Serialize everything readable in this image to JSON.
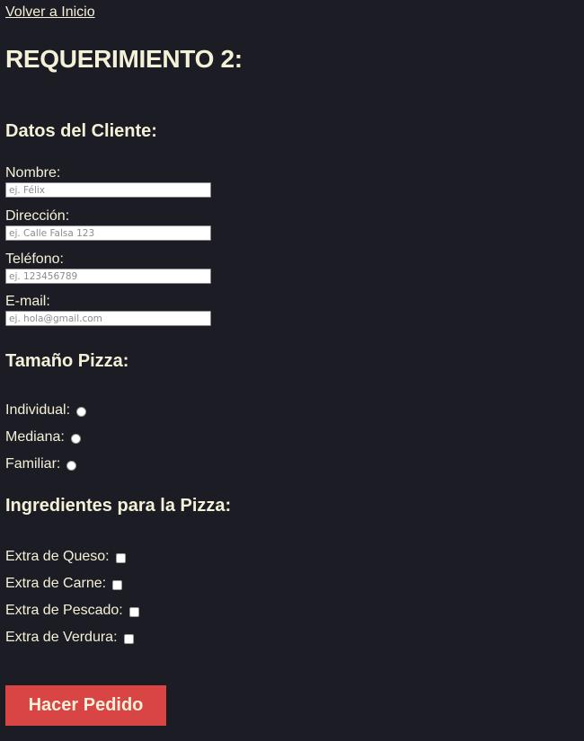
{
  "nav": {
    "back_link": "Volver a Inicio"
  },
  "page": {
    "title": "REQUERIMIENTO 2:"
  },
  "client": {
    "heading": "Datos del Cliente:",
    "fields": [
      {
        "label": "Nombre:",
        "placeholder": "ej. Félix",
        "value": ""
      },
      {
        "label": "Dirección:",
        "placeholder": "ej. Calle Falsa 123",
        "value": ""
      },
      {
        "label": "Teléfono:",
        "placeholder": "ej. 123456789",
        "value": ""
      },
      {
        "label": "E-mail:",
        "placeholder": "ej. hola@gmail.com",
        "value": ""
      }
    ]
  },
  "size": {
    "heading": "Tamaño Pizza:",
    "options": [
      {
        "label": "Individual:",
        "checked": false
      },
      {
        "label": "Mediana:",
        "checked": false
      },
      {
        "label": "Familiar:",
        "checked": false
      }
    ]
  },
  "ingredients": {
    "heading": "Ingredientes para la Pizza:",
    "options": [
      {
        "label": "Extra de Queso:",
        "checked": false
      },
      {
        "label": "Extra de Carne:",
        "checked": false
      },
      {
        "label": "Extra de Pescado:",
        "checked": false
      },
      {
        "label": "Extra de Verdura:",
        "checked": false
      }
    ]
  },
  "actions": {
    "submit_label": "Hacer Pedido"
  },
  "colors": {
    "background": "#1c1d24",
    "text": "#f5f0d8",
    "button": "#d94444"
  }
}
